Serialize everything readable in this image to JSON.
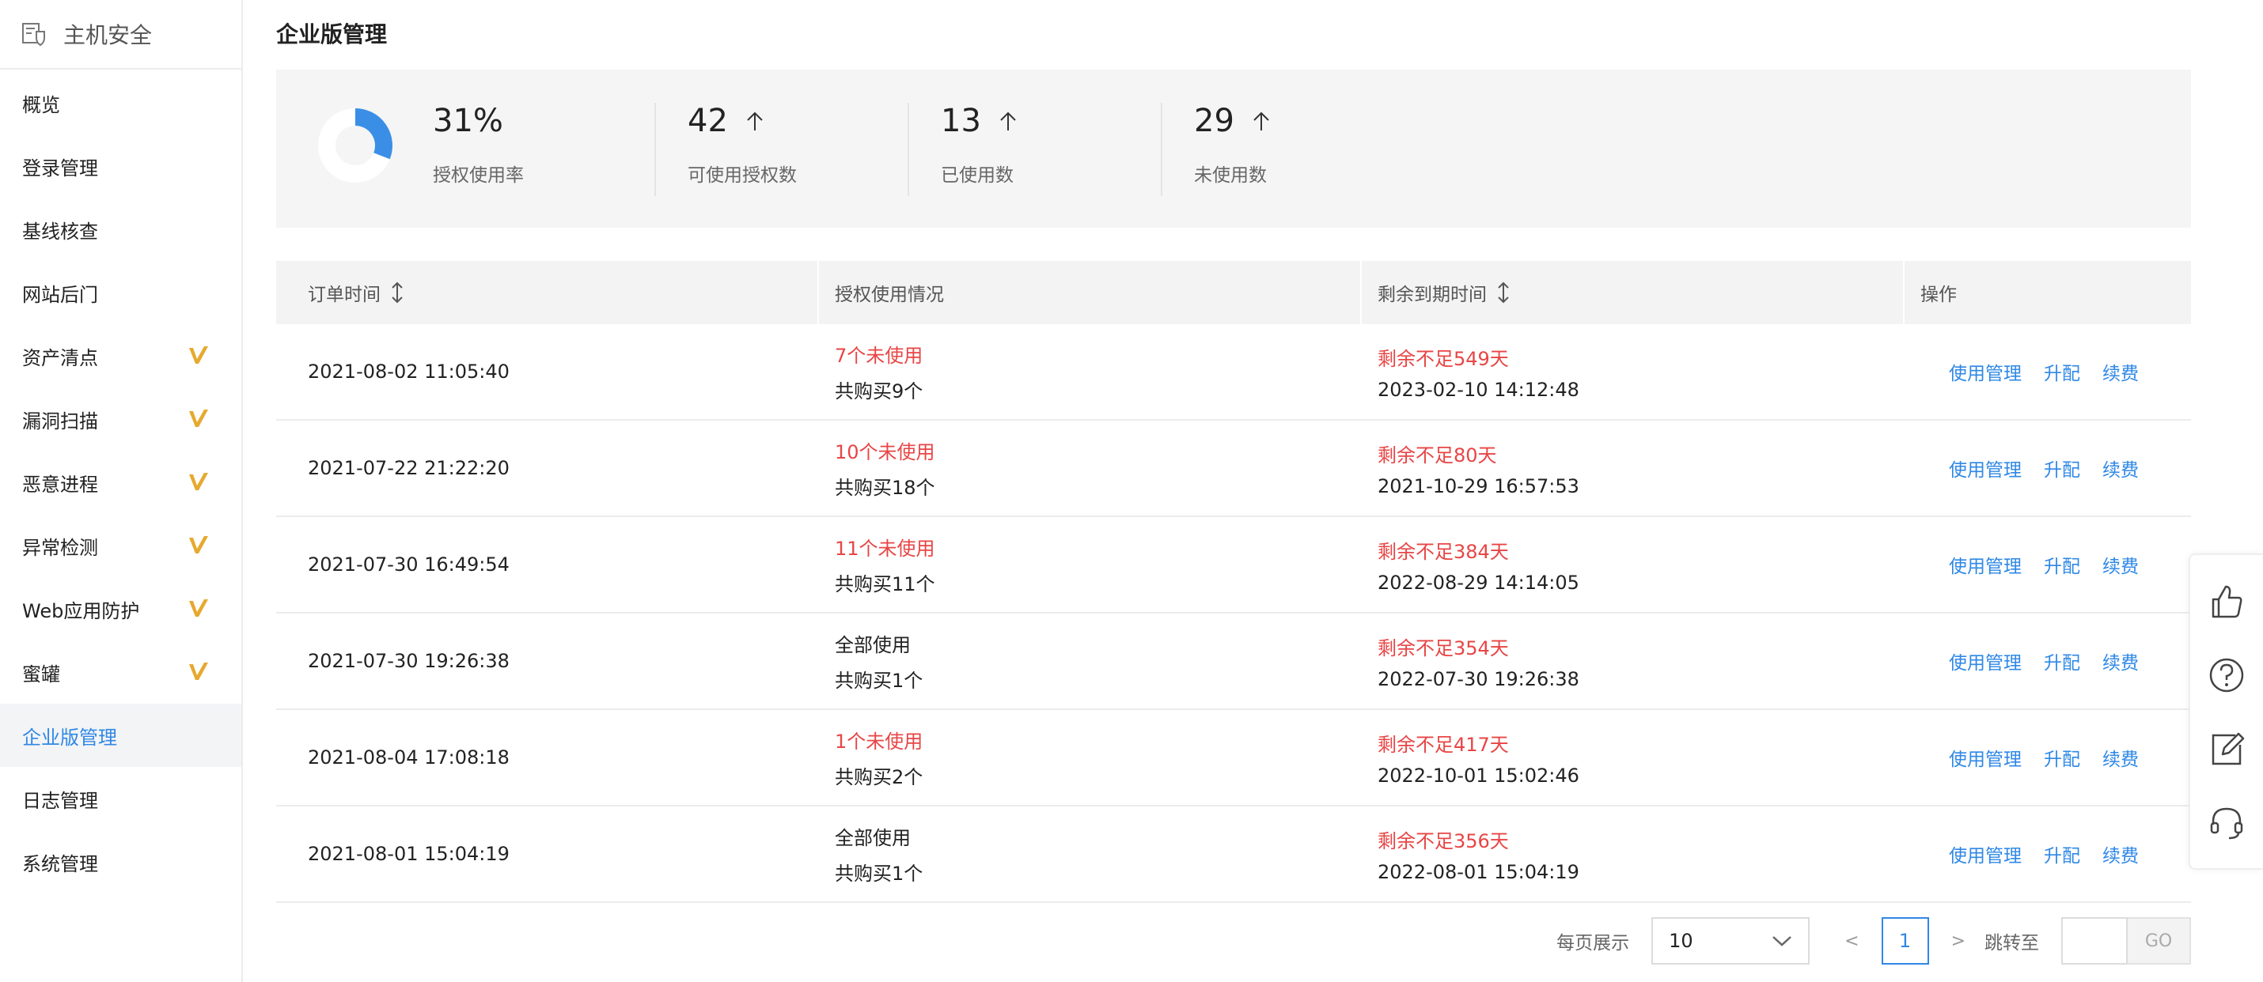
{
  "sidebar": {
    "brand": "主机安全",
    "items": [
      {
        "label": "概览",
        "vip": false,
        "active": false
      },
      {
        "label": "登录管理",
        "vip": false,
        "active": false
      },
      {
        "label": "基线核查",
        "vip": false,
        "active": false
      },
      {
        "label": "网站后门",
        "vip": false,
        "active": false
      },
      {
        "label": "资产清点",
        "vip": true,
        "active": false
      },
      {
        "label": "漏洞扫描",
        "vip": true,
        "active": false
      },
      {
        "label": "恶意进程",
        "vip": true,
        "active": false
      },
      {
        "label": "异常检测",
        "vip": true,
        "active": false
      },
      {
        "label": "Web应用防护",
        "vip": true,
        "active": false
      },
      {
        "label": "蜜罐",
        "vip": true,
        "active": false
      },
      {
        "label": "企业版管理",
        "vip": false,
        "active": true
      },
      {
        "label": "日志管理",
        "vip": false,
        "active": false
      },
      {
        "label": "系统管理",
        "vip": false,
        "active": false
      }
    ]
  },
  "page": {
    "title": "企业版管理"
  },
  "stats": {
    "usage_rate": {
      "value": "31%",
      "label": "授权使用率",
      "fraction": 0.31
    },
    "available": {
      "value": "42",
      "label": "可使用授权数"
    },
    "used": {
      "value": "13",
      "label": "已使用数"
    },
    "unused": {
      "value": "29",
      "label": "未使用数"
    }
  },
  "table": {
    "headers": [
      "订单时间",
      "授权使用情况",
      "剩余到期时间",
      "操作"
    ],
    "actions": [
      "使用管理",
      "升配",
      "续费"
    ],
    "rows": [
      {
        "order_time": "2021-08-02 11:05:40",
        "usage": "7个未使用",
        "usage_warn": true,
        "total": "共购买9个",
        "remain": "剩余不足549天",
        "expire": "2023-02-10 14:12:48"
      },
      {
        "order_time": "2021-07-22 21:22:20",
        "usage": "10个未使用",
        "usage_warn": true,
        "total": "共购买18个",
        "remain": "剩余不足80天",
        "expire": "2021-10-29 16:57:53"
      },
      {
        "order_time": "2021-07-30 16:49:54",
        "usage": "11个未使用",
        "usage_warn": true,
        "total": "共购买11个",
        "remain": "剩余不足384天",
        "expire": "2022-08-29 14:14:05"
      },
      {
        "order_time": "2021-07-30 19:26:38",
        "usage": "全部使用",
        "usage_warn": false,
        "total": "共购买1个",
        "remain": "剩余不足354天",
        "expire": "2022-07-30 19:26:38"
      },
      {
        "order_time": "2021-08-04 17:08:18",
        "usage": "1个未使用",
        "usage_warn": true,
        "total": "共购买2个",
        "remain": "剩余不足417天",
        "expire": "2022-10-01 15:02:46"
      },
      {
        "order_time": "2021-08-01 15:04:19",
        "usage": "全部使用",
        "usage_warn": false,
        "total": "共购买1个",
        "remain": "剩余不足356天",
        "expire": "2022-08-01 15:04:19"
      }
    ]
  },
  "pagination": {
    "page_size_label": "每页展示",
    "page_size": "10",
    "prev": "<",
    "current_page": "1",
    "next": ">",
    "jump_label": "跳转至",
    "go_label": "GO"
  },
  "float_toolbar": {
    "icons": [
      "thumbs-up-icon",
      "help-icon",
      "edit-icon",
      "headset-icon"
    ]
  },
  "colors": {
    "accent": "#2f88e6",
    "warning": "#e84545",
    "vip": "#e6a92f",
    "donut_track": "#ffffff",
    "donut_fill": "#3a8ee6"
  }
}
